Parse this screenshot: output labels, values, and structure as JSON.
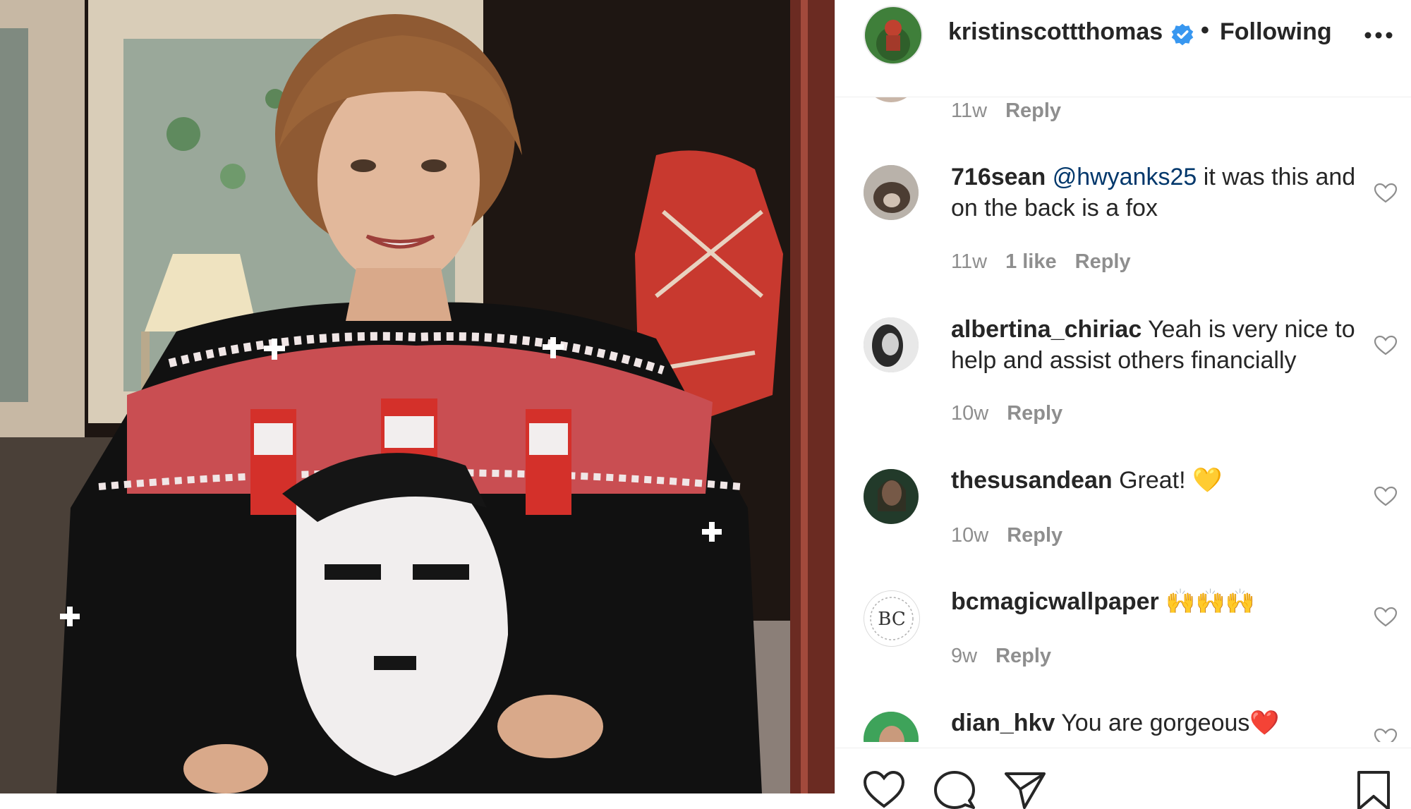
{
  "post": {
    "username": "kristinscottthomas",
    "separator": "•",
    "follow_status": "Following",
    "verified_icon": "verified-badge-icon",
    "more_icon": "more-options-icon"
  },
  "comments": [
    {
      "username": "",
      "text": "",
      "time": "11w",
      "likes": "",
      "reply": "Reply"
    },
    {
      "username": "716sean",
      "mention": "@hwyanks25",
      "text": " it was this and on the back is a fox",
      "time": "11w",
      "likes": "1 like",
      "reply": "Reply"
    },
    {
      "username": "albertina_chiriac",
      "text": " Yeah is very nice to help and assist others financially",
      "time": "10w",
      "reply": "Reply"
    },
    {
      "username": "thesusandean",
      "text": " Great! 💛",
      "time": "10w",
      "reply": "Reply"
    },
    {
      "username": "bcmagicwallpaper",
      "text": " 🙌🙌🙌",
      "time": "9w",
      "reply": "Reply",
      "avatar_text": "BC"
    },
    {
      "username": "dian_hkv",
      "text": " You are gorgeous❤️"
    }
  ],
  "actions": {
    "icons": [
      "heart-icon",
      "comment-icon",
      "share-icon",
      "bookmark-icon"
    ]
  },
  "colors": {
    "text": "#262626",
    "muted": "#8e8e8e",
    "mention": "#00376b",
    "verified": "#3897f0",
    "border": "#efefef"
  }
}
